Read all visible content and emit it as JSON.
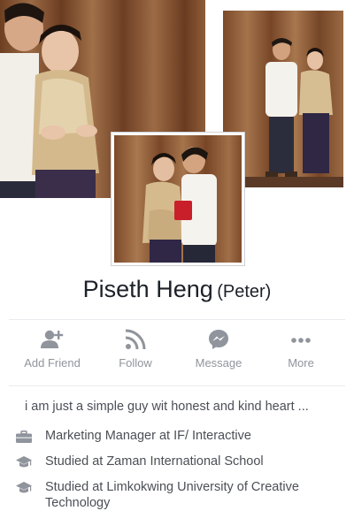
{
  "profile": {
    "name": "Piseth Heng",
    "alternate_name": "(Peter)"
  },
  "actions": [
    {
      "label": "Add Friend",
      "icon": "add-friend-icon"
    },
    {
      "label": "Follow",
      "icon": "follow-icon"
    },
    {
      "label": "Message",
      "icon": "messenger-icon"
    },
    {
      "label": "More",
      "icon": "more-icon"
    }
  ],
  "bio": "i am just a simple guy wit honest and kind heart ...",
  "intro": [
    {
      "icon": "briefcase-icon",
      "text": "Marketing Manager at IF/ Interactive"
    },
    {
      "icon": "graduation-cap-icon",
      "text": "Studied at Zaman International School"
    },
    {
      "icon": "graduation-cap-icon",
      "text": "Studied at Limkokwing University of Creative Technology"
    }
  ],
  "colors": {
    "icon_gray": "#90949c",
    "text_gray": "#4b4f56",
    "name_dark": "#1d2129",
    "curtain": "#8a5a36"
  }
}
